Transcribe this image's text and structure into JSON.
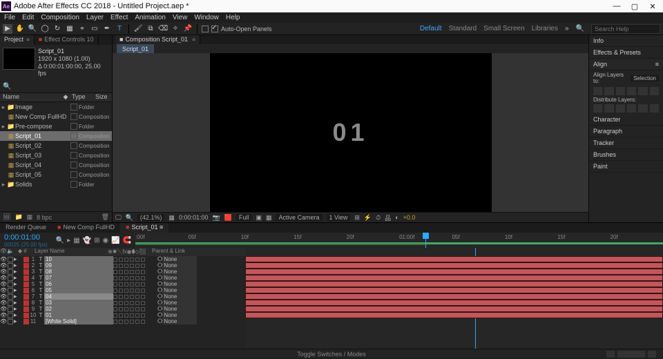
{
  "title": "Adobe After Effects CC 2018 - Untitled Project.aep *",
  "menu": [
    "File",
    "Edit",
    "Composition",
    "Layer",
    "Effect",
    "Animation",
    "View",
    "Window",
    "Help"
  ],
  "toolbar": {
    "auto_open": "Auto-Open Panels",
    "workspaces": [
      "Default",
      "Standard",
      "Small Screen",
      "Libraries"
    ],
    "ws_active": 0,
    "search_ph": "Search Help"
  },
  "project": {
    "tab1": "Project",
    "tab2": "Effect Controls 10",
    "sel_name": "Script_01",
    "sel_res": "1920 x 1080 (1.00)",
    "sel_dur": "Δ 0:00:01:00:00, 25.00 fps",
    "cols": {
      "name": "Name",
      "type": "Type",
      "size": "Size"
    },
    "items": [
      {
        "name": "Image",
        "type": "Folder",
        "kind": "folder",
        "tw": "▸"
      },
      {
        "name": "New Comp FullHD",
        "type": "Composition",
        "kind": "comp",
        "tw": ""
      },
      {
        "name": "Pre-compose",
        "type": "Folder",
        "kind": "folder",
        "tw": "▸"
      },
      {
        "name": "Script_01",
        "type": "Composition",
        "kind": "comp",
        "tw": "",
        "sel": true
      },
      {
        "name": "Script_02",
        "type": "Composition",
        "kind": "comp",
        "tw": ""
      },
      {
        "name": "Script_03",
        "type": "Composition",
        "kind": "comp",
        "tw": ""
      },
      {
        "name": "Script_04",
        "type": "Composition",
        "kind": "comp",
        "tw": ""
      },
      {
        "name": "Script_05",
        "type": "Composition",
        "kind": "comp",
        "tw": ""
      },
      {
        "name": "Solids",
        "type": "Folder",
        "kind": "folder",
        "tw": "▸"
      }
    ],
    "bpc": "8 bpc"
  },
  "comp": {
    "tab": "Composition Script_01",
    "subtab": "Script_01",
    "big": "01",
    "foot": {
      "zoom": "(42.1%)",
      "time": "0:00:01:00",
      "res": "Full",
      "cam": "Active Camera",
      "view": "1 View",
      "px": "+0.0"
    }
  },
  "right": {
    "info": "Info",
    "ep": "Effects & Presets",
    "align": "Align",
    "align_to": "Align Layers to:",
    "align_sel": "Selection",
    "dist": "Distribute Layers:",
    "char": "Character",
    "para": "Paragraph",
    "track": "Tracker",
    "brush": "Brushes",
    "paint": "Paint"
  },
  "timeline": {
    "tabs": [
      "Render Queue",
      "New Comp FullHD",
      "Script_01"
    ],
    "active_tab": 2,
    "current": "0:00:01:00",
    "frame_info": "00025 (25.00 fps)",
    "cols": {
      "layer": "Layer Name",
      "parent": "Parent & Link",
      "none": "None"
    },
    "ruler": [
      ":00f",
      "05f",
      "10f",
      "15f",
      "20f",
      "01:00f",
      "05f",
      "10f",
      "15f",
      "20f"
    ],
    "layers": [
      {
        "n": 1,
        "t": "T",
        "name": "10"
      },
      {
        "n": 2,
        "t": "T",
        "name": "09"
      },
      {
        "n": 3,
        "t": "T",
        "name": "08"
      },
      {
        "n": 4,
        "t": "T",
        "name": "07"
      },
      {
        "n": 5,
        "t": "T",
        "name": "06"
      },
      {
        "n": 6,
        "t": "T",
        "name": "05"
      },
      {
        "n": 7,
        "t": "T",
        "name": "04",
        "sel": true
      },
      {
        "n": 8,
        "t": "T",
        "name": "03"
      },
      {
        "n": 9,
        "t": "T",
        "name": "02"
      },
      {
        "n": 10,
        "t": "T",
        "name": "01"
      },
      {
        "n": 11,
        "t": "",
        "name": "[White Solid]"
      }
    ],
    "toggle": "Toggle Switches / Modes"
  }
}
